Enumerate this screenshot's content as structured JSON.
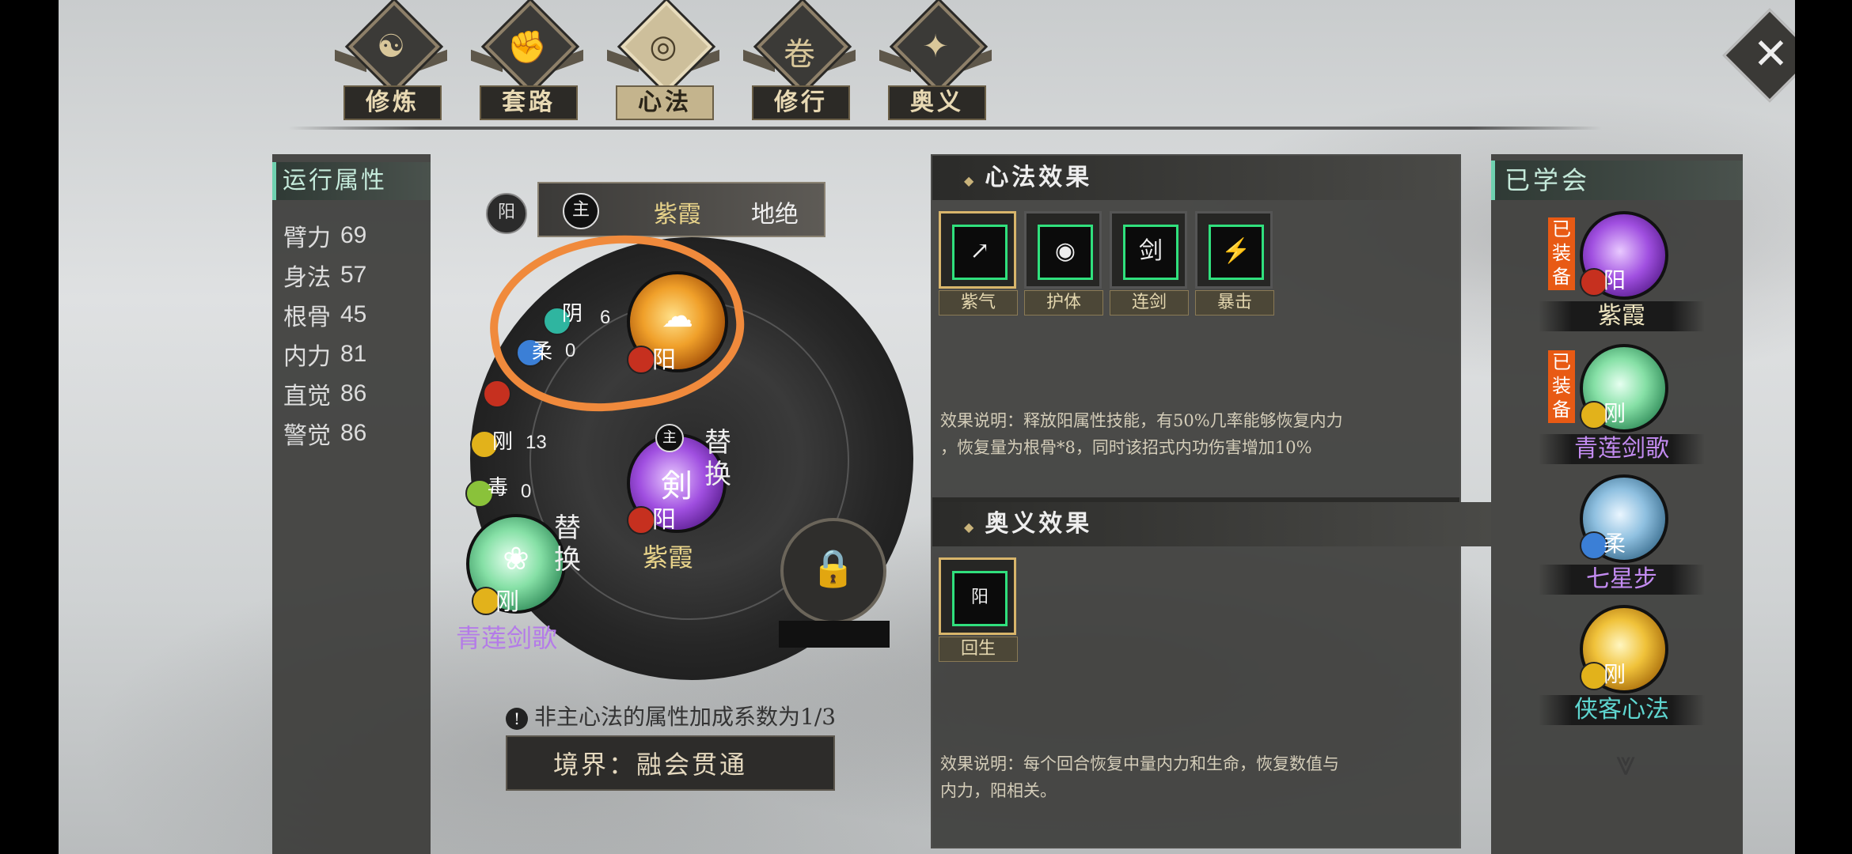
{
  "tabs": [
    {
      "label": "修炼",
      "glyph": "☯"
    },
    {
      "label": "套路",
      "glyph": "✊"
    },
    {
      "label": "心法",
      "glyph": "◎"
    },
    {
      "label": "修行",
      "glyph": "卷"
    },
    {
      "label": "奥义",
      "glyph": "✦"
    }
  ],
  "close_glyph": "✕",
  "attributes": {
    "title": "运行属性",
    "rows": [
      {
        "name": "臂力",
        "value": "69"
      },
      {
        "name": "身法",
        "value": "57"
      },
      {
        "name": "根骨",
        "value": "45"
      },
      {
        "name": "内力",
        "value": "81"
      },
      {
        "name": "直觉",
        "value": "86"
      },
      {
        "name": "警觉",
        "value": "86"
      }
    ]
  },
  "main_bar": {
    "yang": "阳",
    "zhu": "主",
    "name1": "紫霞",
    "name2": "地绝"
  },
  "stats": {
    "yin_label": "阴",
    "yin_value": "6",
    "rou_label": "柔",
    "rou_value": "0",
    "gang_label": "刚",
    "gang_value": "13",
    "du_label": "毒",
    "du_value": "0"
  },
  "orbs": {
    "gold_elem": "阳",
    "purple_zhu": "主",
    "purple_elem": "阳",
    "purple_name": "紫霞",
    "green_elem": "刚",
    "green_name": "青莲剑歌",
    "replace_label": "替换"
  },
  "hint": "非主心法的属性加成系数为1/3",
  "realm": "境界：融会贯通",
  "effects": {
    "title": "心法效果",
    "skills": [
      {
        "label": "紫气",
        "icon": "↗"
      },
      {
        "label": "护体",
        "icon": "◉"
      },
      {
        "label": "连剑",
        "icon": "剑"
      },
      {
        "label": "暴击",
        "icon": "⚡"
      }
    ],
    "desc_line1": "效果说明：释放阳属性技能，有50%几率能够恢复内力",
    "desc_line2": "，恢复量为根骨*8，同时该招式内功伤害增加10%",
    "aoyi_title": "奥义效果",
    "aoyi_skill": {
      "label": "回生",
      "icon": "阳"
    },
    "aoyi_desc_line1": "效果说明：每个回合恢复中量内力和生命，恢复数值与",
    "aoyi_desc_line2": "内力，阳相关。"
  },
  "learned": {
    "title": "已学会",
    "items": [
      {
        "name": "紫霞",
        "equip": "已装备",
        "elem": "阳",
        "name_color": "#f0e6c0"
      },
      {
        "name": "青莲剑歌",
        "equip": "已装备",
        "elem": "刚",
        "name_color": "#c48cf2"
      },
      {
        "name": "七星步",
        "equip": "",
        "elem": "柔",
        "name_color": "#c48cf2"
      },
      {
        "name": "侠客心法",
        "equip": "",
        "elem": "刚",
        "name_color": "#5fd6d0"
      }
    ]
  },
  "down_arrow": "⩔"
}
